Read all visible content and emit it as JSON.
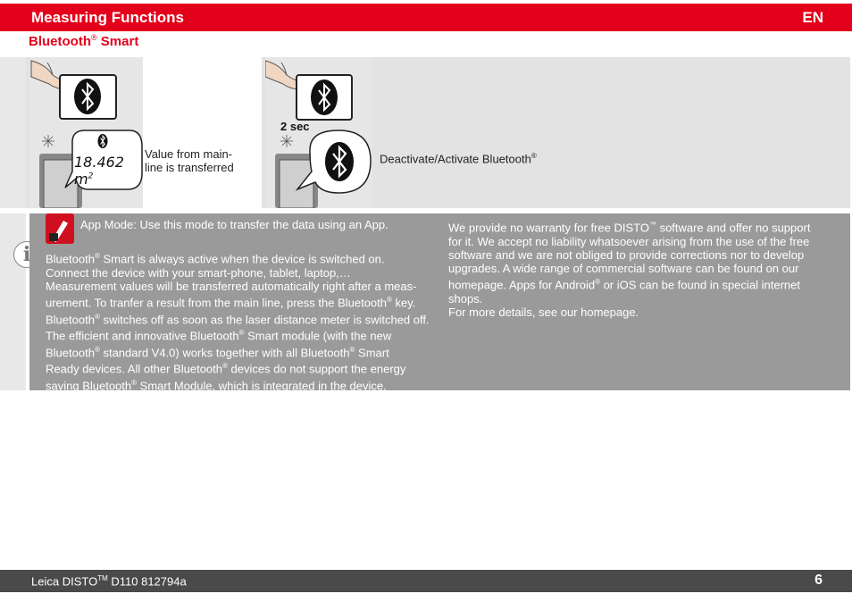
{
  "header": {
    "title": "Measuring Functions",
    "lang": "EN"
  },
  "section": {
    "title": "Bluetooth",
    "title_reg": "®",
    "title_rest": " Smart"
  },
  "panel_a": {
    "display_value": "18.462 m",
    "display_unit_sup": "2",
    "caption_line1": "Value from main-",
    "caption_line2": "line is transferred"
  },
  "panel_b": {
    "duration": "2 sec",
    "caption": "Deactivate/Activate Bluetooth",
    "caption_reg": "®"
  },
  "info": {
    "icon": "i",
    "app_mode": "App Mode: Use this mode to transfer the data using an App.",
    "p1_a": "Bluetooth",
    "p1_b": " Smart is always active when the device is switched on.",
    "p1_c": "Connect the device with your smart-phone, tablet, laptop,…",
    "p2_l1": "Measurement values will be transferred automatically right after a meas-",
    "p2_l2a": "urement. To tranfer a result from the main line, press the Bluetooth",
    "p2_l2b": " key.",
    "p2_l3a": "Bluetooth",
    "p2_l3b": " switches off as soon as the laser distance meter is switched off.",
    "p2_l4a": "The efficient and innovative Bluetooth",
    "p2_l4b": " Smart module (with the new",
    "p2_l5a": "Bluetooth",
    "p2_l5b": " standard V4.0) works together with all Bluetooth",
    "p2_l5c": " Smart",
    "p2_l6a": "Ready devices. All other Bluetooth",
    "p2_l6b": " devices do not support the energy",
    "p2_l7a": "saving Bluetooth",
    "p2_l7b": " Smart Module, which is integrated in the device.",
    "r_l1a": "We provide no warranty for free DISTO",
    "r_l1tm": "™",
    "r_l1b": " software and offer no support",
    "r_l2": "for it. We accept no liability whatsoever arising from the use of the free",
    "r_l3": "software and we are not obliged to provide corrections nor to develop",
    "r_l4": "upgrades. A wide range of commercial software can be found on our",
    "r_l5a": "homepage. Apps for Android",
    "r_l5b": " or iOS can be found in special internet",
    "r_l6": "shops.",
    "r_l7": "For more details, see our homepage.",
    "reg": "®"
  },
  "footer": {
    "product": "Leica DISTO",
    "tm": "TM",
    "model": " D110 812794a",
    "page": "6"
  },
  "colors": {
    "brand": "#e3001b",
    "info_bg": "#9a9a9a",
    "footer_bg": "#4a4a4a"
  }
}
